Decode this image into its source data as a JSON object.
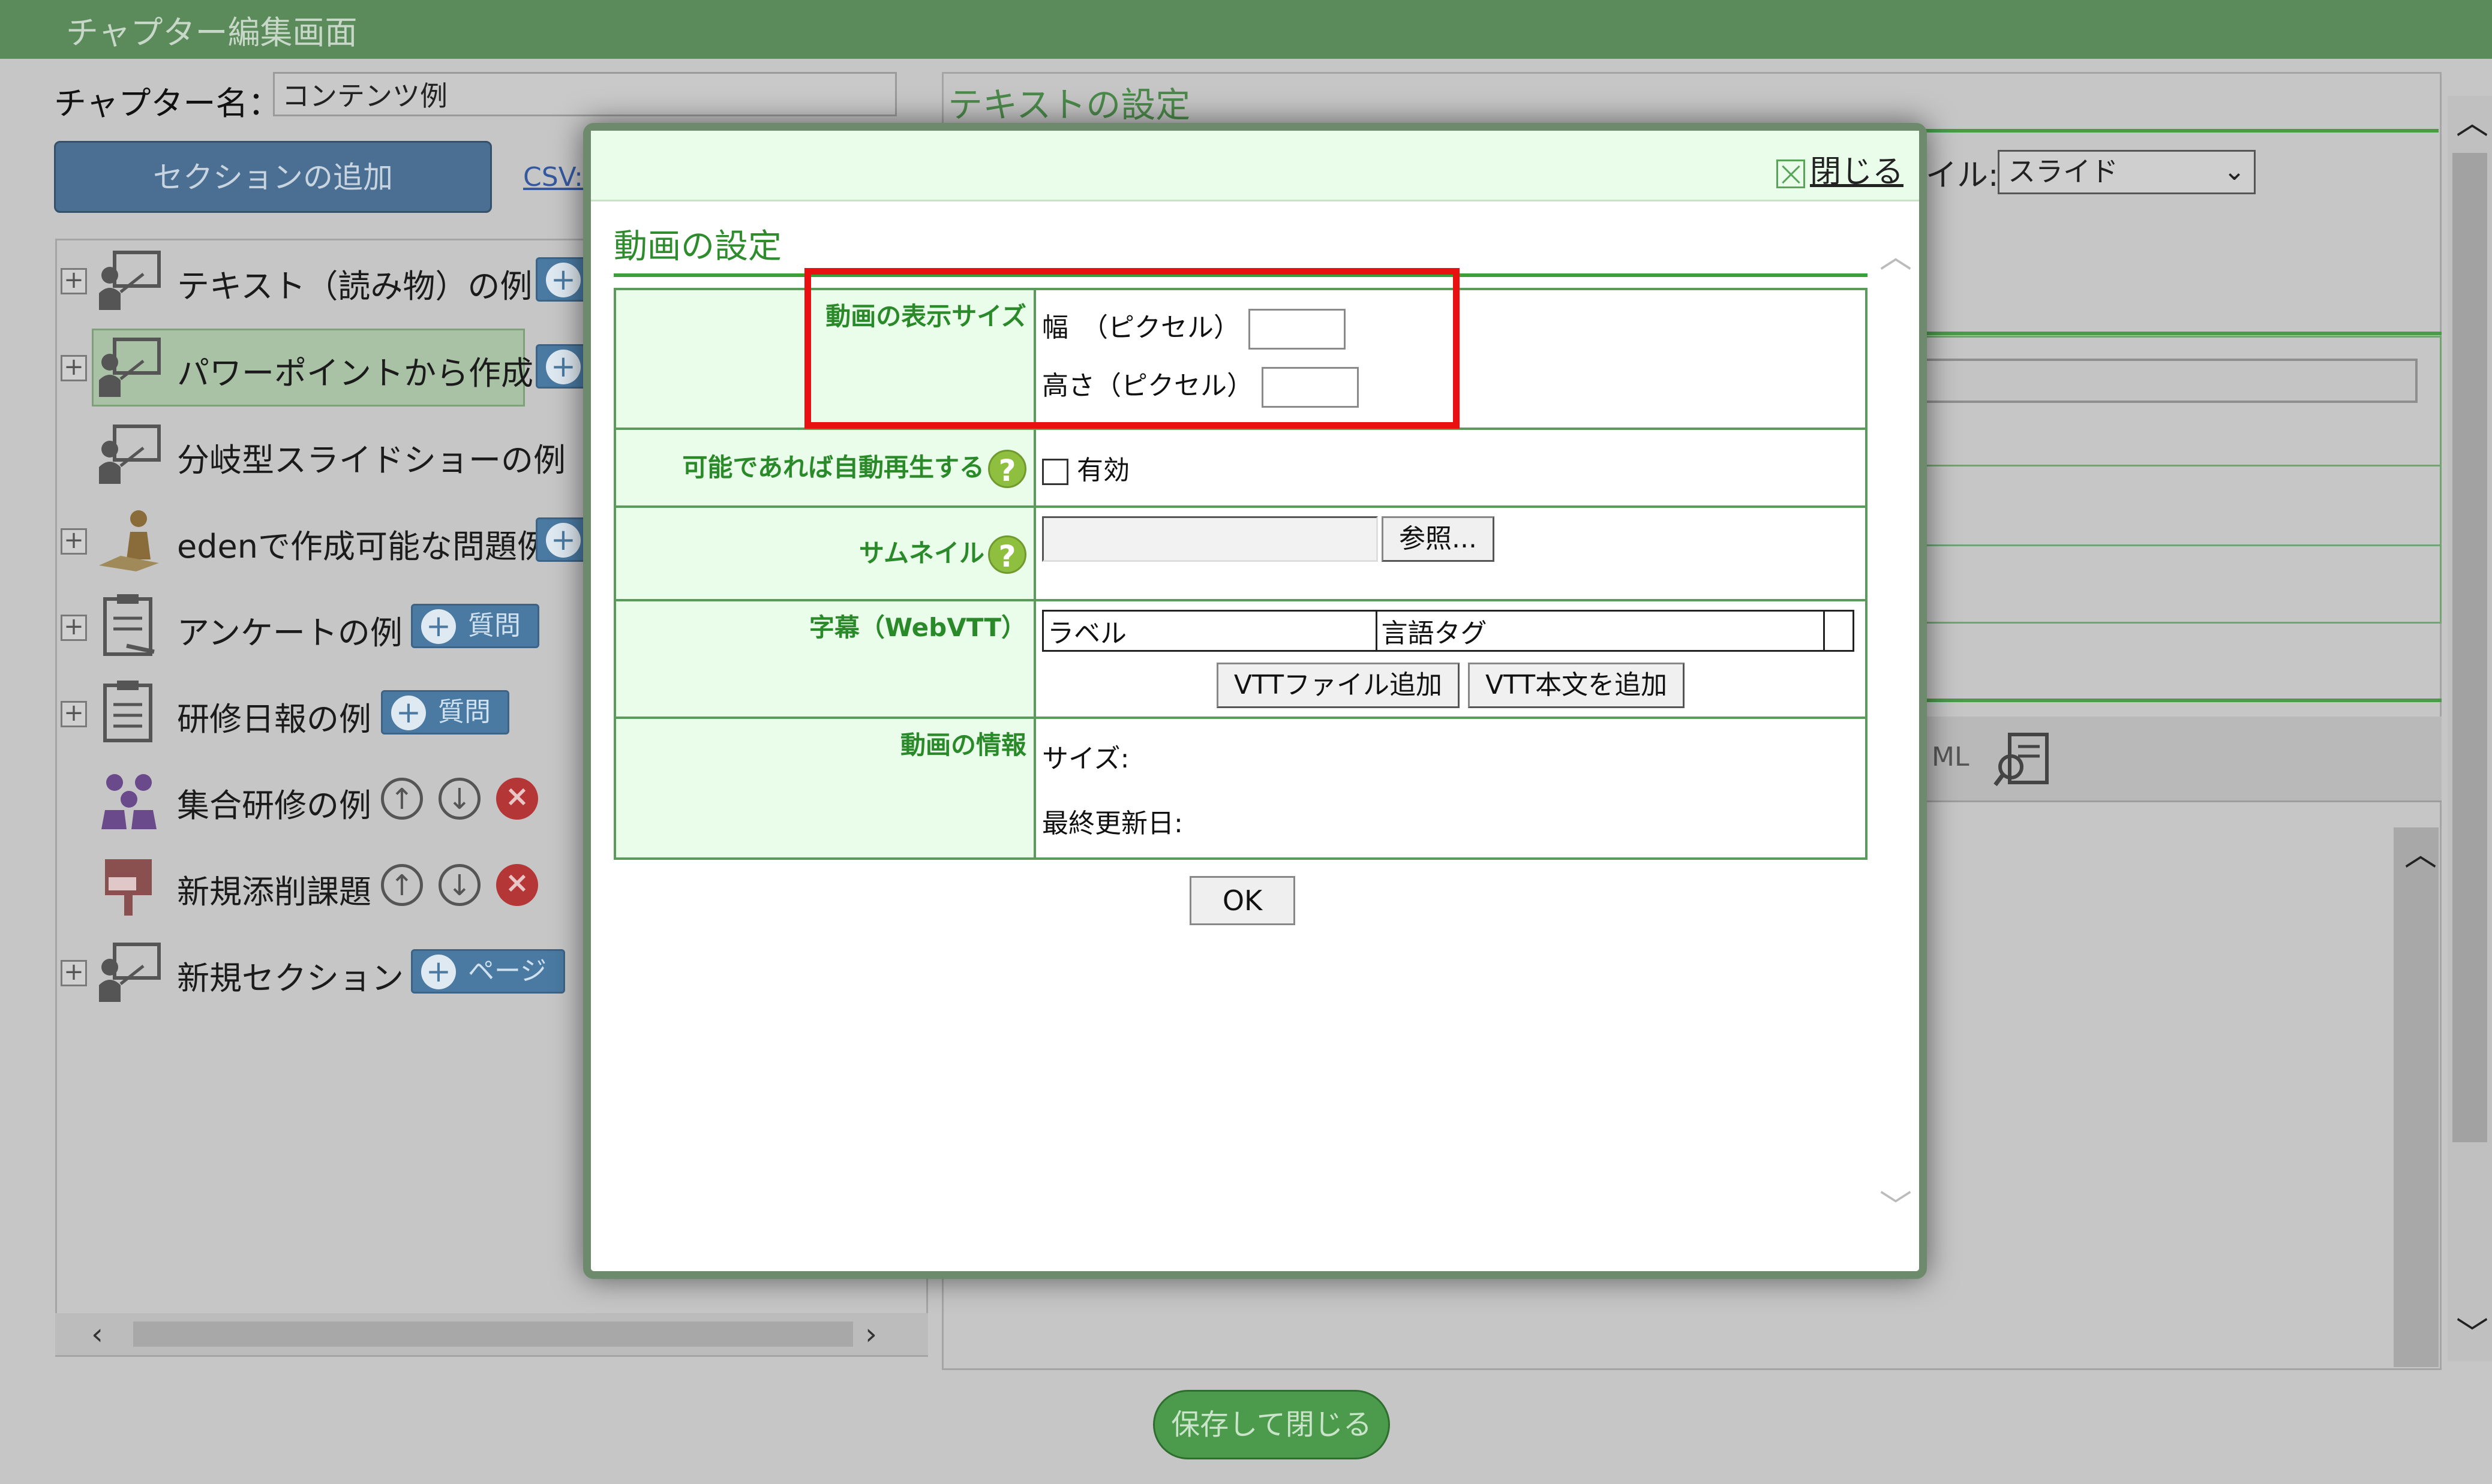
{
  "window": {
    "title": "チャプター編集画面"
  },
  "chapter": {
    "name_label": "チャプター名：",
    "name_value": "コンテンツ例"
  },
  "left": {
    "add_section_label": "セクションの追加",
    "csv_link": "CSV:",
    "tree": [
      {
        "label": "テキスト（読み物）の例",
        "expandable": true,
        "icon": "lecture-icon"
      },
      {
        "label": "パワーポイントから作成",
        "expandable": true,
        "icon": "lecture-icon",
        "selected": true
      },
      {
        "label": "分岐型スライドショーの例",
        "expandable": false,
        "icon": "lecture-icon"
      },
      {
        "label": "edenで作成可能な問題例",
        "expandable": true,
        "icon": "study-icon"
      },
      {
        "label": "アンケートの例",
        "expandable": true,
        "icon": "clipboard-icon",
        "action": "質問"
      },
      {
        "label": "研修日報の例",
        "expandable": true,
        "icon": "clipboard-icon",
        "action": "質問"
      },
      {
        "label": "集合研修の例",
        "expandable": false,
        "icon": "group-icon"
      },
      {
        "label": "新規添削課題",
        "expandable": false,
        "icon": "post-icon"
      },
      {
        "label": "新規セクション",
        "expandable": true,
        "icon": "lecture-icon",
        "action": "ページ"
      }
    ]
  },
  "right": {
    "text_settings_title": "テキストの設定",
    "style_label": "イル:",
    "style_value": "スライド",
    "toolbar_html": "ML"
  },
  "footer": {
    "save_close_label": "保存して閉じる"
  },
  "modal": {
    "close_label": "閉じる",
    "title": "動画の設定",
    "display_size": {
      "label": "動画の表示サイズ",
      "width_label": "幅　（ピクセル）",
      "height_label": "高さ（ピクセル）",
      "width_value": "",
      "height_value": ""
    },
    "autoplay": {
      "label": "可能であれば自動再生する",
      "checkbox_label": "有効",
      "checked": false
    },
    "thumbnail": {
      "label": "サムネイル",
      "browse_label": "参照..."
    },
    "subtitles": {
      "label": "字幕（WebVTT）",
      "col_label": "ラベル",
      "col_lang": "言語タグ",
      "add_file_label": "VTTファイル追加",
      "add_text_label": "VTT本文を追加"
    },
    "info": {
      "label": "動画の情報",
      "size_label": "サイズ:",
      "updated_label": "最終更新日:"
    },
    "ok_label": "OK"
  },
  "colors": {
    "header_green": "#5b8a5b",
    "accent_green": "#3aa03a",
    "highlight_red": "#e81010",
    "button_blue": "#4a7aa2"
  }
}
